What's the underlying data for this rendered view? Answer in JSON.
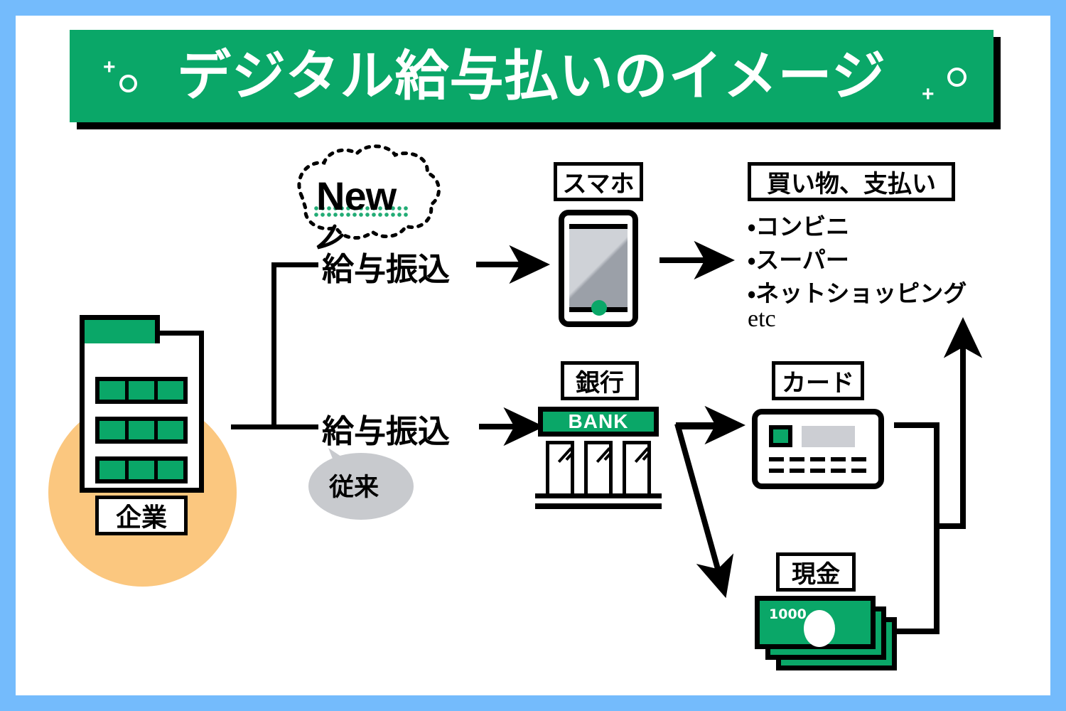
{
  "frame": {
    "border_color": "#74bbfc"
  },
  "theme": {
    "green": "#0aa768",
    "orange": "#fbc77f",
    "gray": "#ccced3",
    "black": "#000000",
    "white": "#ffffff"
  },
  "banner": {
    "title": "デジタル給与払いのイメージ",
    "background": "#0aa768",
    "text_color": "#ffffff",
    "decorations": [
      "plus",
      "circle",
      "circle",
      "plus"
    ]
  },
  "nodes": {
    "company": {
      "label": "企業",
      "circle_color": "#fbc77f",
      "roof_color": "#0aa768",
      "window_rows": 3,
      "windows_per_row": 3
    },
    "smartphone": {
      "label": "スマホ",
      "home_button_color": "#0aa768"
    },
    "bank": {
      "label": "銀行",
      "sign_text": "BANK",
      "sign_color": "#0aa768",
      "panels": 3
    },
    "card": {
      "label": "カード",
      "chip_color": "#0aa768",
      "dash_rows": 2,
      "dashes_per_row": 5
    },
    "cash": {
      "label": "現金",
      "denomination": "1000",
      "bill_color": "#0aa768",
      "bill_count": 3
    },
    "shopping": {
      "label": "買い物、支払い",
      "items": [
        "・コンビニ",
        "・スーパー",
        "・ネットショッピング"
      ],
      "etc": "etc"
    }
  },
  "flows": {
    "top_transfer_label": "給与振込",
    "bottom_transfer_label": "給与振込",
    "new_badge": "New",
    "legacy_badge": "従来"
  }
}
